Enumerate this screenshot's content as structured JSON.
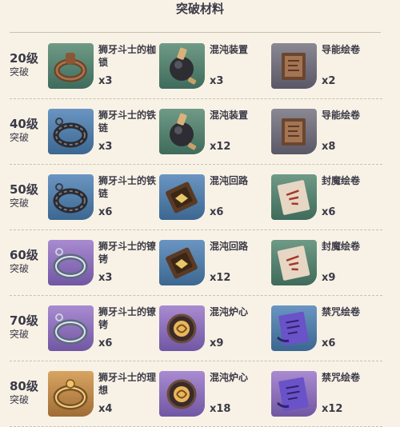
{
  "page": {
    "title": "突破材料"
  },
  "tiers": [
    {
      "level": "20级",
      "label": "突破",
      "materials": [
        {
          "name": "狮牙斗士的枷锁",
          "count": "x3",
          "icon": "shackle-icon",
          "rarity": "green"
        },
        {
          "name": "混沌装置",
          "count": "x3",
          "icon": "chaos-device-icon",
          "rarity": "green"
        },
        {
          "name": "导能绘卷",
          "count": "x2",
          "icon": "scroll-icon",
          "rarity": "gray"
        }
      ]
    },
    {
      "level": "40级",
      "label": "突破",
      "materials": [
        {
          "name": "狮牙斗士的铁链",
          "count": "x3",
          "icon": "iron-chain-icon",
          "rarity": "blue"
        },
        {
          "name": "混沌装置",
          "count": "x12",
          "icon": "chaos-device-icon",
          "rarity": "green"
        },
        {
          "name": "导能绘卷",
          "count": "x8",
          "icon": "scroll-icon",
          "rarity": "gray"
        }
      ]
    },
    {
      "level": "50级",
      "label": "突破",
      "materials": [
        {
          "name": "狮牙斗士的铁链",
          "count": "x6",
          "icon": "iron-chain-icon",
          "rarity": "blue"
        },
        {
          "name": "混沌回路",
          "count": "x6",
          "icon": "chaos-circuit-icon",
          "rarity": "blue"
        },
        {
          "name": "封魔绘卷",
          "count": "x6",
          "icon": "sealed-scroll-icon",
          "rarity": "green"
        }
      ]
    },
    {
      "level": "60级",
      "label": "突破",
      "materials": [
        {
          "name": "狮牙斗士的镣铐",
          "count": "x3",
          "icon": "fetters-icon",
          "rarity": "purple"
        },
        {
          "name": "混沌回路",
          "count": "x12",
          "icon": "chaos-circuit-icon",
          "rarity": "blue"
        },
        {
          "name": "封魔绘卷",
          "count": "x9",
          "icon": "sealed-scroll-icon",
          "rarity": "green"
        }
      ]
    },
    {
      "level": "70级",
      "label": "突破",
      "materials": [
        {
          "name": "狮牙斗士的镣铐",
          "count": "x6",
          "icon": "fetters-icon",
          "rarity": "purple"
        },
        {
          "name": "混沌炉心",
          "count": "x9",
          "icon": "chaos-core-icon",
          "rarity": "purple"
        },
        {
          "name": "禁咒绘卷",
          "count": "x6",
          "icon": "forbidden-scroll-icon",
          "rarity": "blue"
        }
      ]
    },
    {
      "level": "80级",
      "label": "突破",
      "materials": [
        {
          "name": "狮牙斗士的理想",
          "count": "x4",
          "icon": "ideal-icon",
          "rarity": "gold"
        },
        {
          "name": "混沌炉心",
          "count": "x18",
          "icon": "chaos-core-icon",
          "rarity": "purple"
        },
        {
          "name": "禁咒绘卷",
          "count": "x12",
          "icon": "forbidden-scroll-icon",
          "rarity": "purple"
        }
      ]
    }
  ],
  "colors": {
    "background": "#f8f2e6",
    "text": "#3b3a47",
    "rarity_green": "#4a7d6b",
    "rarity_blue": "#4a75a0",
    "rarity_purple": "#8a6cb8",
    "rarity_gold": "#c08b48",
    "rarity_gray": "#6e6c78"
  }
}
